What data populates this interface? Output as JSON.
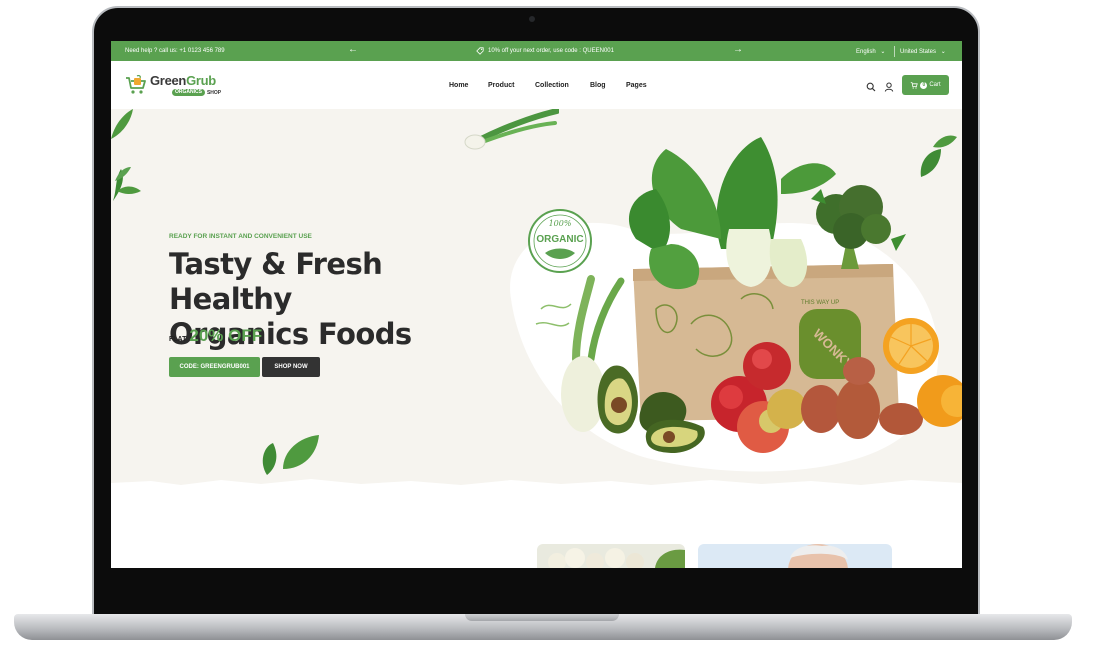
{
  "topbar": {
    "help_text": "Need help ? call us:",
    "phone": "+1 0123 456 789",
    "promo_text": "10% off your next order, use code : QUEEN001",
    "language": "English",
    "country": "United States"
  },
  "header": {
    "logo_text_1": "Green",
    "logo_text_2": "Grub",
    "logo_pill": "ORGANICS",
    "logo_shop": "SHOP",
    "nav": [
      "Home",
      "Product",
      "Collection",
      "Blog",
      "Pages"
    ],
    "cart_count": "0",
    "cart_label": "Cart"
  },
  "hero": {
    "tagline": "READY FOR INSTANT AND CONVENIENT USE",
    "title_line1": "Tasty & Fresh Healthy",
    "title_line2": "Organics Foods",
    "flat_label": "FLAT",
    "discount": "20% OFF",
    "code_button": "CODE: GREENGRUB001",
    "shop_button": "SHOP NOW",
    "badge_top": "100%",
    "badge_text": "ORGANIC",
    "box_text_1": "THIS WAY UP",
    "box_text_2": "WONKY"
  },
  "colors": {
    "brand_green": "#5aa150",
    "dark": "#333333",
    "hero_bg": "#f6f4ef"
  },
  "icons": [
    "arrow-left-icon",
    "arrow-right-icon",
    "tag-icon",
    "chevron-down-icon",
    "search-icon",
    "user-icon",
    "cart-icon"
  ]
}
